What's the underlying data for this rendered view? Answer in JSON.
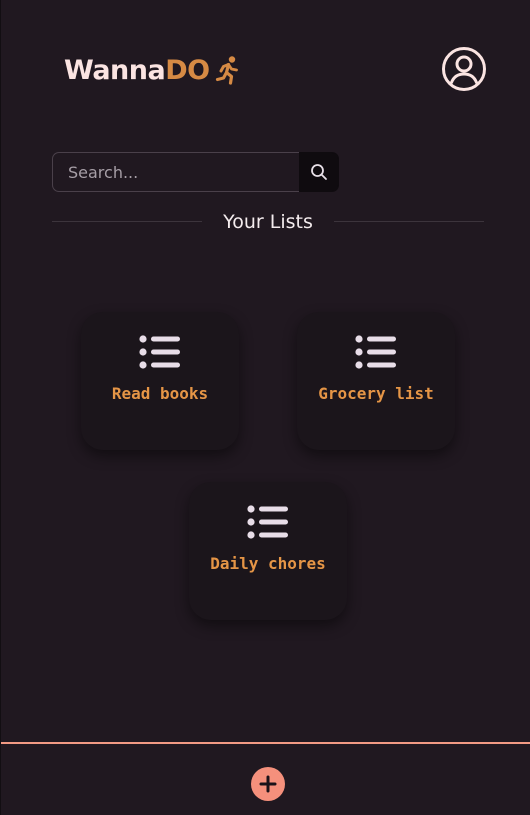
{
  "header": {
    "logo_part1": "Wanna",
    "logo_part2": "DO",
    "logo_icon": "running-person-icon",
    "profile_icon": "user-circle-icon"
  },
  "search": {
    "placeholder": "Search...",
    "value": "",
    "button_icon": "search-icon"
  },
  "section": {
    "title": "Your Lists"
  },
  "lists": [
    {
      "label": "Read books",
      "icon": "list-icon"
    },
    {
      "label": "Grocery list",
      "icon": "list-icon"
    },
    {
      "label": "Daily chores",
      "icon": "list-icon"
    }
  ],
  "footer": {
    "add_icon": "plus-icon"
  },
  "colors": {
    "background": "#201820",
    "accent_orange": "#e59546",
    "accent_salmon": "#f29a84",
    "logo_light": "#fbe4e2"
  }
}
